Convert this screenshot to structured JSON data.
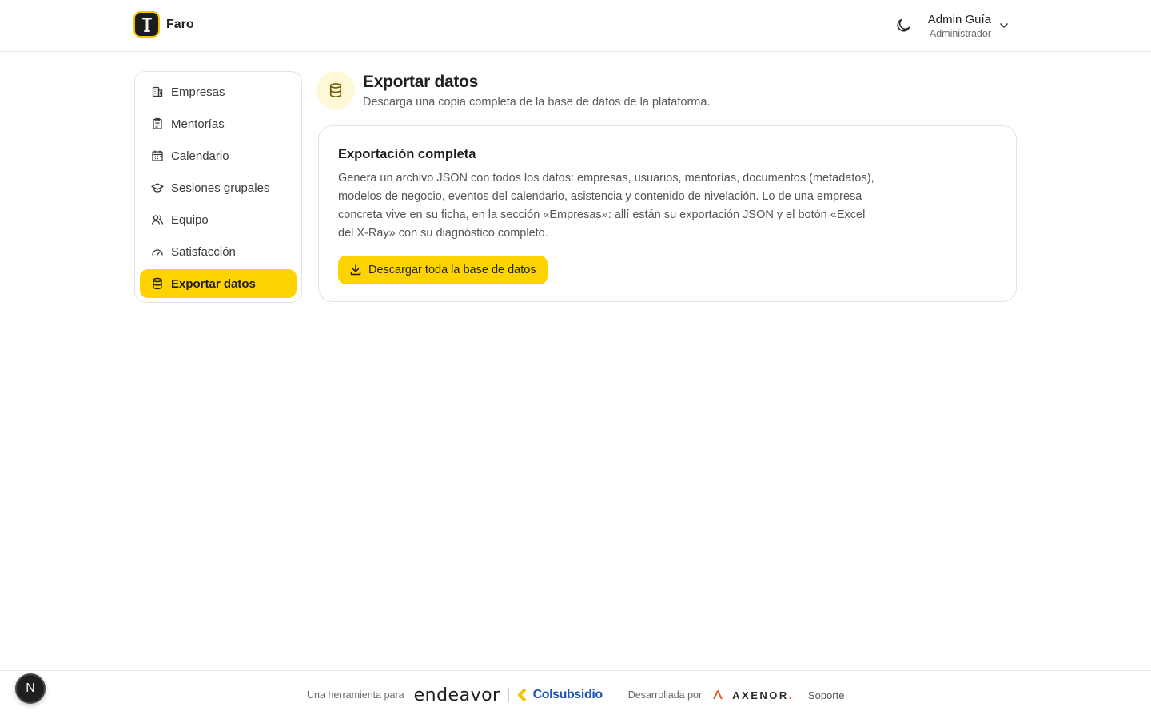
{
  "header": {
    "brand_name": "Faro",
    "user_name": "Admin Guía",
    "user_role": "Administrador"
  },
  "sidebar": {
    "items": [
      {
        "label": "Empresas",
        "icon": "building-icon"
      },
      {
        "label": "Mentorías",
        "icon": "clipboard-icon"
      },
      {
        "label": "Calendario",
        "icon": "calendar-icon"
      },
      {
        "label": "Sesiones grupales",
        "icon": "graduation-cap-icon"
      },
      {
        "label": "Equipo",
        "icon": "users-icon"
      },
      {
        "label": "Satisfacción",
        "icon": "gauge-icon"
      },
      {
        "label": "Exportar datos",
        "icon": "database-icon",
        "active": true
      }
    ]
  },
  "page": {
    "title": "Exportar datos",
    "subtitle": "Descarga una copia completa de la base de datos de la plataforma."
  },
  "card": {
    "title": "Exportación completa",
    "text": "Genera un archivo JSON con todos los datos: empresas, usuarios, mentorías, documentos (metadatos), modelos de negocio, eventos del calendario, asistencia y contenido de nivelación. Lo de una empresa concreta vive en su ficha, en la sección «Empresas»: allí están su exportación JSON y el botón «Excel del X-Ray» con su diagnóstico completo.",
    "button_label": "Descargar toda la base de datos"
  },
  "footer": {
    "tool_for": "Una herramienta para",
    "endeavor": "endeavor",
    "colsubsidio": "Colsubsidio",
    "developed_by": "Desarrollada por",
    "axenor": "AXENOR",
    "axenor_dot": ".",
    "support": "Soporte"
  },
  "dev_badge": "N",
  "colors": {
    "accent": "#ffd300",
    "accent_soft": "#fff8d6",
    "colsubsidio_blue": "#1d56b8",
    "axenor_orange": "#e85a1c"
  }
}
